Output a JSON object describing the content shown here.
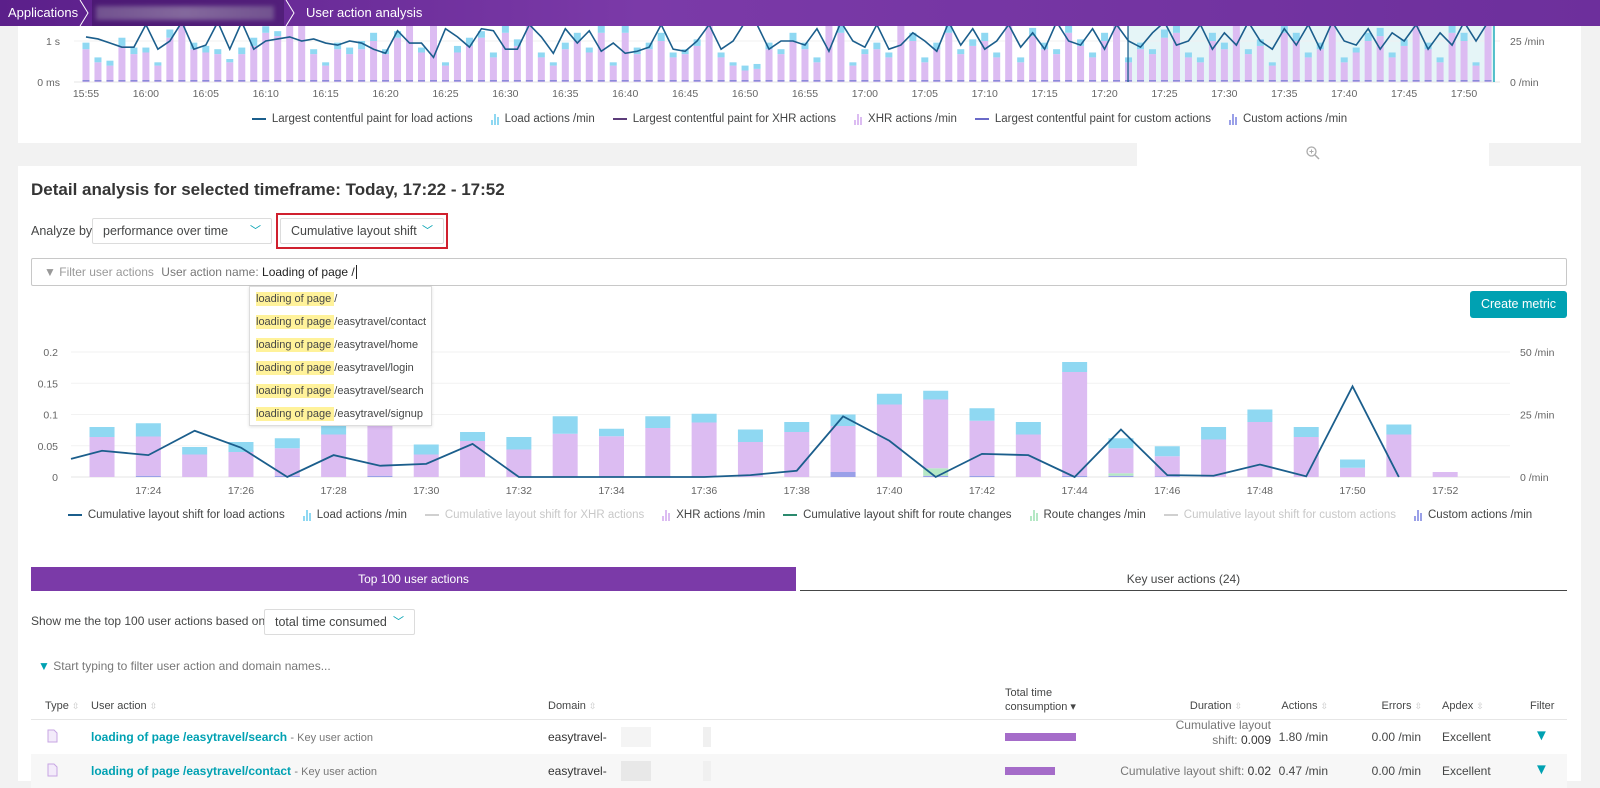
{
  "breadcrumb": {
    "items": [
      "Applications",
      "User action analysis"
    ]
  },
  "colors": {
    "header": "#6d2f9c",
    "accent": "#00a1b2",
    "tab_active": "#7b3aa8",
    "load": "#8fd8f2",
    "xhr": "#dcbcf2",
    "route": "#b5e8c5",
    "custom": "#9aa0e8",
    "line_load": "#1b5e8c",
    "line_route": "#2b8a6e",
    "highlight": "#fff29a",
    "focus_border": "#d0202e"
  },
  "overview_chart": {
    "type": "bar",
    "x_start": "15:55",
    "interval_min": 1,
    "x_tick_labels": [
      "15:55",
      "16:00",
      "16:05",
      "16:10",
      "16:15",
      "16:20",
      "16:25",
      "16:30",
      "16:35",
      "16:40",
      "16:45",
      "16:50",
      "16:55",
      "17:00",
      "17:05",
      "17:10",
      "17:15",
      "17:20",
      "17:25",
      "17:30",
      "17:35",
      "17:40",
      "17:45",
      "17:50"
    ],
    "y_left_ticks": [
      "0 ms",
      "1 s"
    ],
    "y_right_ticks": [
      "0 /min",
      "25 /min"
    ],
    "selected_range": [
      "17:22",
      "17:52"
    ],
    "legend": [
      {
        "label": "Largest contentful paint for load actions",
        "kind": "line",
        "color": "#1b5e8c"
      },
      {
        "label": "Load actions /min",
        "kind": "bar",
        "color": "#8fd8f2"
      },
      {
        "label": "Largest contentful paint for XHR actions",
        "kind": "line",
        "color": "#5c3c7a"
      },
      {
        "label": "XHR actions /min",
        "kind": "bar",
        "color": "#dcbcf2"
      },
      {
        "label": "Largest contentful paint for custom actions",
        "kind": "line",
        "color": "#6a6ac8"
      },
      {
        "label": "Custom actions /min",
        "kind": "bar",
        "color": "#9aa0e8"
      }
    ],
    "xhr_per_min": [
      20,
      12,
      10,
      22,
      17,
      18,
      10,
      27,
      35,
      20,
      18,
      17,
      12,
      17,
      22,
      30,
      28,
      35,
      35,
      17,
      10,
      20,
      17,
      20,
      25,
      17,
      27,
      35,
      18,
      35,
      10,
      18,
      22,
      27,
      15,
      30,
      22,
      35,
      15,
      10,
      20,
      25,
      18,
      30,
      10,
      30,
      17,
      20,
      25,
      15,
      17,
      22,
      35,
      15,
      10,
      7,
      8,
      20,
      17,
      25,
      20,
      12,
      35,
      30,
      10,
      17,
      20,
      15,
      35,
      25,
      12,
      20,
      30,
      17,
      22,
      25,
      15,
      35,
      12,
      28,
      20,
      17,
      30,
      22,
      15,
      25,
      35,
      12,
      20,
      17,
      27,
      30,
      15,
      12,
      25,
      20,
      35,
      17,
      22,
      10,
      30,
      25,
      15,
      20,
      35,
      12,
      18,
      25,
      28,
      15,
      22,
      35,
      20,
      12,
      30,
      25,
      10,
      35
    ],
    "load_per_min": [
      4,
      3,
      3,
      5,
      4,
      3,
      2,
      5,
      0,
      4,
      4,
      3,
      2,
      4,
      5,
      4,
      3,
      0,
      0,
      3,
      2,
      4,
      4,
      5,
      5,
      3,
      4,
      0,
      3,
      0,
      2,
      4,
      5,
      4,
      3,
      5,
      4,
      0,
      3,
      2,
      4,
      5,
      3,
      5,
      2,
      5,
      4,
      4,
      5,
      3,
      3,
      4,
      0,
      3,
      2,
      3,
      3,
      4,
      3,
      5,
      4,
      3,
      0,
      5,
      2,
      3,
      4,
      3,
      0,
      5,
      3,
      4,
      5,
      3,
      4,
      5,
      3,
      0,
      3,
      5,
      4,
      3,
      5,
      4,
      3,
      5,
      0,
      3,
      4,
      3,
      5,
      5,
      3,
      3,
      5,
      4,
      0,
      3,
      4,
      2,
      5,
      5,
      3,
      4,
      0,
      3,
      3,
      5,
      5,
      3,
      4,
      0,
      4,
      3,
      5,
      5,
      2,
      0
    ],
    "lcp_load_s": [
      1.1,
      1.05,
      0.95,
      0.85,
      0.85,
      1.4,
      0.8,
      1.0,
      1.5,
      0.8,
      0.9,
      1.5,
      0.8,
      1.5,
      0.8,
      1.0,
      1.05,
      1.1,
      1.0,
      1.05,
      0.95,
      0.9,
      1.0,
      0.95,
      0.8,
      0.7,
      1.25,
      0.95,
      0.95,
      0.6,
      1.3,
      1.1,
      0.85,
      1.3,
      1.25,
      0.8,
      0.8,
      1.4,
      1.1,
      0.7,
      1.3,
      0.95,
      1.25,
      0.75,
      0.95,
      0.7,
      0.75,
      0.85,
      1.4,
      0.8,
      0.75,
      1.0,
      1.4,
      0.8,
      1.0,
      1.5,
      1.4,
      0.8,
      1.0,
      1.0,
      0.9,
      1.3,
      0.75,
      1.5,
      1.0,
      0.85,
      1.4,
      0.8,
      0.9,
      1.2,
      1.0,
      0.75,
      1.5,
      0.9,
      1.3,
      0.8,
      1.0,
      1.4,
      0.85,
      1.2,
      0.8,
      1.5,
      1.0,
      0.9,
      1.3,
      0.8,
      1.4,
      1.0,
      0.85,
      1.2,
      1.5,
      0.9,
      1.0,
      1.4,
      0.8,
      1.2,
      0.9,
      1.5,
      1.0,
      0.8,
      1.3,
      0.9,
      1.4,
      0.8,
      1.5,
      1.0,
      0.9,
      1.3,
      0.8,
      1.2,
      1.0,
      1.4,
      0.8,
      1.2,
      0.9,
      1.5,
      1.0,
      1.5
    ]
  },
  "detail": {
    "title": "Detail analysis for selected timeframe: Today, 17:22 - 17:52",
    "analyze_by_label": "Analyze by",
    "analyze_by_value": "performance over time",
    "metric_value": "Cumulative layout shift",
    "filter": {
      "placeholder": "Filter user actions",
      "key": "User action name:",
      "value": "Loading of page /"
    },
    "suggestions": [
      {
        "match": "loading of page ",
        "rest": "/"
      },
      {
        "match": "loading of page ",
        "rest": "/easytravel/contact"
      },
      {
        "match": "loading of page ",
        "rest": "/easytravel/home"
      },
      {
        "match": "loading of page ",
        "rest": "/easytravel/login"
      },
      {
        "match": "loading of page ",
        "rest": "/easytravel/search"
      },
      {
        "match": "loading of page ",
        "rest": "/easytravel/signup"
      }
    ],
    "create_metric": "Create metric"
  },
  "chart_data": {
    "type": "bar",
    "x": [
      "17:23",
      "17:24",
      "17:25",
      "17:26",
      "17:27",
      "17:28",
      "17:29",
      "17:30",
      "17:31",
      "17:32",
      "17:33",
      "17:34",
      "17:35",
      "17:36",
      "17:37",
      "17:38",
      "17:39",
      "17:40",
      "17:41",
      "17:42",
      "17:43",
      "17:44",
      "17:45",
      "17:46",
      "17:47",
      "17:48",
      "17:49",
      "17:50",
      "17:51",
      "17:52"
    ],
    "x_tick_labels": [
      "17:24",
      "17:26",
      "17:28",
      "17:30",
      "17:32",
      "17:34",
      "17:36",
      "17:38",
      "17:40",
      "17:42",
      "17:44",
      "17:46",
      "17:48",
      "17:50",
      "17:52"
    ],
    "y_left_ticks": [
      "0",
      "0.05",
      "0.1",
      "0.15",
      "0.2"
    ],
    "y_left_range": [
      0,
      0.2
    ],
    "y_right_ticks": [
      "0 /min",
      "25 /min",
      "50 /min"
    ],
    "y_right_range": [
      0,
      50
    ],
    "grid": true,
    "legend_placement": "bottom",
    "series": [
      {
        "name": "Load actions /min",
        "kind": "bar",
        "color": "#8fd8f2",
        "values": [
          4,
          5.3,
          3,
          4,
          4,
          5,
          2,
          4,
          3.6,
          5,
          7,
          3,
          4.7,
          3.5,
          5,
          4,
          4.6,
          4.3,
          3.5,
          5,
          5,
          4,
          4,
          4,
          5,
          5,
          4,
          3.3,
          4,
          0
        ]
      },
      {
        "name": "XHR actions /min",
        "kind": "bar",
        "color": "#dcbcf2",
        "values": [
          16,
          15.7,
          9,
          10,
          11,
          17,
          23,
          9,
          14.4,
          11,
          17,
          16,
          19.3,
          21.5,
          14,
          18,
          18.4,
          29,
          27.5,
          22,
          17,
          41.5,
          10,
          8,
          15,
          22,
          16,
          3.7,
          17,
          2
        ]
      },
      {
        "name": "Route changes /min",
        "kind": "bar",
        "color": "#b5e8c5",
        "values": [
          0,
          0,
          0,
          0,
          0,
          0,
          0,
          0,
          0,
          0,
          0,
          0,
          0,
          0,
          0,
          0,
          0,
          0,
          3,
          0,
          0,
          0,
          1,
          0,
          0,
          0,
          0,
          0,
          0,
          0
        ]
      },
      {
        "name": "Custom actions /min",
        "kind": "bar",
        "color": "#9aa0e8",
        "values": [
          0,
          0.5,
          0,
          0,
          0.5,
          0,
          0.5,
          0,
          0,
          0,
          0.3,
          0.3,
          0.3,
          0.3,
          0,
          0,
          2,
          0,
          0.5,
          0.5,
          0,
          0.5,
          0.5,
          0.3,
          0,
          0,
          0,
          0,
          0,
          0
        ]
      },
      {
        "name": "Cumulative layout shift for load actions",
        "kind": "line",
        "color": "#1b5e8c",
        "values": [
          0.042,
          0.035,
          0.074,
          0.047,
          0,
          0.035,
          0.018,
          0.021,
          0.053,
          0,
          0,
          0,
          0,
          0,
          0.003,
          0.01,
          0.097,
          0.058,
          0,
          0.037,
          0.035,
          0,
          0.076,
          0.003,
          0.002,
          0.02,
          0.001,
          0.145,
          0,
          null
        ]
      }
    ],
    "legend": [
      {
        "label": "Cumulative layout shift for load actions",
        "kind": "line",
        "color": "#1b5e8c",
        "enabled": true
      },
      {
        "label": "Load actions /min",
        "kind": "bar",
        "color": "#8fd8f2",
        "enabled": true
      },
      {
        "label": "Cumulative layout shift for XHR actions",
        "kind": "line",
        "color": "#d0d0d0",
        "enabled": false
      },
      {
        "label": "XHR actions /min",
        "kind": "bar",
        "color": "#dcbcf2",
        "enabled": true
      },
      {
        "label": "Cumulative layout shift for route changes",
        "kind": "line",
        "color": "#2b8a6e",
        "enabled": true
      },
      {
        "label": "Route changes /min",
        "kind": "bar",
        "color": "#b5e8c5",
        "enabled": true
      },
      {
        "label": "Cumulative layout shift for custom actions",
        "kind": "line",
        "color": "#d0d0d0",
        "enabled": false
      },
      {
        "label": "Custom actions /min",
        "kind": "bar",
        "color": "#9aa0e8",
        "enabled": true
      }
    ]
  },
  "tabs": [
    {
      "label": "Top 100 user actions",
      "active": true
    },
    {
      "label": "Key user actions (24)",
      "active": false
    }
  ],
  "top": {
    "label": "Show me the top 100 user actions based on",
    "value": "total time consumed",
    "filter_placeholder": "Start typing to filter user action and domain names..."
  },
  "table": {
    "headers": {
      "type": "Type",
      "action": "User action",
      "domain": "Domain",
      "total1": "Total time",
      "total2": "consumption ▾",
      "duration": "Duration",
      "actions": "Actions",
      "errors": "Errors",
      "apdex": "Apdex",
      "filter": "Filter"
    },
    "rows": [
      {
        "name": "loading of page /easytravel/search",
        "tag": "- Key user action",
        "domain": "easytravel-",
        "total_fraction": 1.0,
        "duration_label": "Cumulative layout",
        "duration_label2": "shift:",
        "duration_value": "0.009",
        "actions": "1.80 /min",
        "errors": "0.00 /min",
        "apdex": "Excellent"
      },
      {
        "name": "loading of page /easytravel/contact",
        "tag": "- Key user action",
        "domain": "easytravel-",
        "total_fraction": 0.7,
        "duration_label": "Cumulative layout shift:",
        "duration_value": "0.02",
        "actions": "0.47 /min",
        "errors": "0.00 /min",
        "apdex": "Excellent"
      }
    ]
  }
}
